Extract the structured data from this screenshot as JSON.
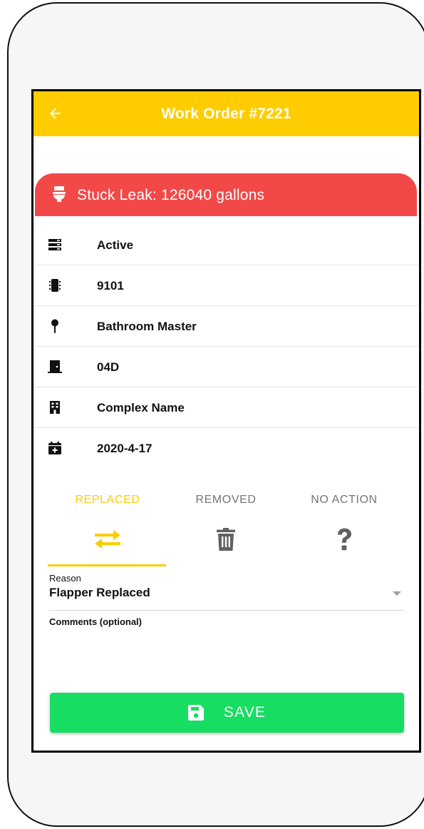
{
  "appbar": {
    "title": "Work Order #7221",
    "back_icon": "arrow-left-icon",
    "background": "#ffcc00"
  },
  "alert": {
    "icon": "toilet-icon",
    "text": "Stuck Leak: 126040 gallons",
    "color": "#f24848"
  },
  "info": {
    "status": "Active",
    "device_id": "9101",
    "location": "Bathroom Master",
    "unit": "04D",
    "complex": "Complex Name",
    "date": "2020-4-17"
  },
  "tabs": [
    {
      "label": "REPLACED",
      "icon": "swap-arrows-icon",
      "active": true
    },
    {
      "label": "REMOVED",
      "icon": "trash-icon",
      "active": false
    },
    {
      "label": "NO ACTION",
      "icon": "question-icon",
      "active": false
    }
  ],
  "reason": {
    "label": "Reason",
    "value": "Flapper Replaced"
  },
  "comments": {
    "label": "Comments (optional)",
    "value": ""
  },
  "save": {
    "label": "SAVE",
    "icon": "floppy-disk-icon",
    "color": "#17dd63"
  }
}
